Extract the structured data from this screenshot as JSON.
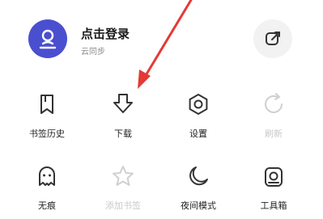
{
  "header": {
    "title": "点击登录",
    "subtitle": "云同步",
    "avatar_icon": "user-avatar-icon",
    "edit_icon": "edit-icon",
    "accent_color": "#4a4fcf"
  },
  "menu": {
    "items": [
      {
        "label": "书签历史",
        "icon": "bookmark-icon",
        "enabled": true
      },
      {
        "label": "下载",
        "icon": "download-icon",
        "enabled": true
      },
      {
        "label": "设置",
        "icon": "settings-icon",
        "enabled": true
      },
      {
        "label": "刷新",
        "icon": "refresh-icon",
        "enabled": false
      },
      {
        "label": "无痕",
        "icon": "incognito-icon",
        "enabled": true
      },
      {
        "label": "添加书签",
        "icon": "star-icon",
        "enabled": false
      },
      {
        "label": "夜间模式",
        "icon": "moon-icon",
        "enabled": true
      },
      {
        "label": "工具箱",
        "icon": "toolbox-icon",
        "enabled": true
      }
    ]
  },
  "annotation": {
    "arrow_color": "#e53935"
  }
}
